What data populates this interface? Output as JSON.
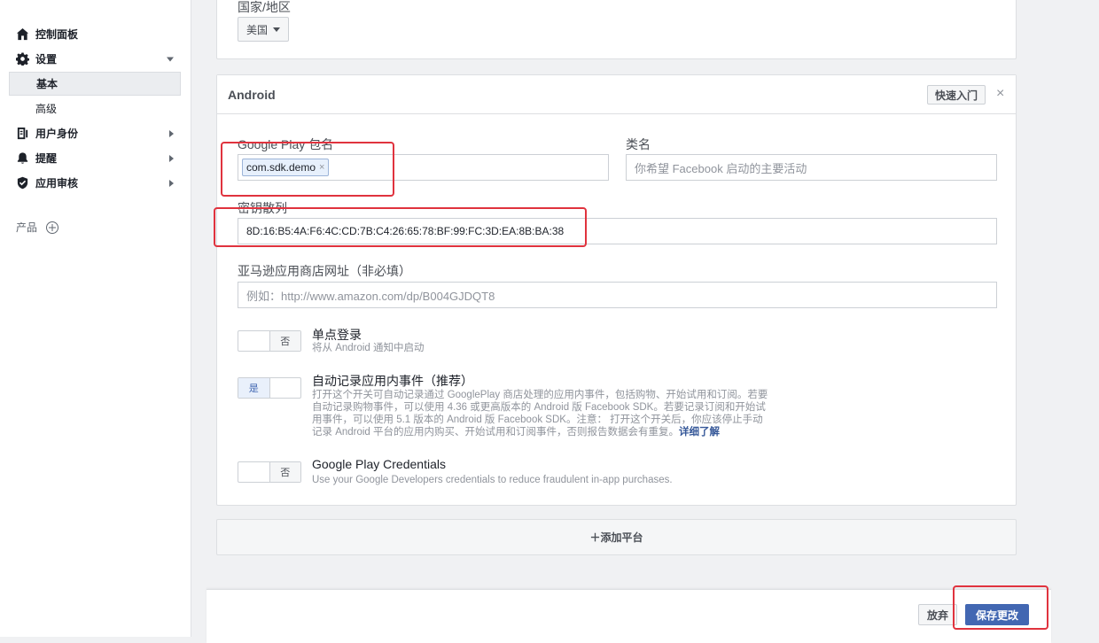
{
  "sidebar": {
    "dashboard": "控制面板",
    "settings": "设置",
    "settings_basic": "基本",
    "settings_advanced": "高级",
    "roles": "用户身份",
    "alerts": "提醒",
    "app_review": "应用审核",
    "products": "产品"
  },
  "country": {
    "label": "国家/地区",
    "value": "美国"
  },
  "android": {
    "title": "Android",
    "quickstart": "快速入门",
    "close": "×",
    "package_label": "Google Play 包名",
    "package_tag": "com.sdk.demo",
    "package_tag_remove": "×",
    "class_label": "类名",
    "class_placeholder": "你希望 Facebook 启动的主要活动",
    "key_hash_label": "密钥散列",
    "key_hash_value": "8D:16:B5:4A:F6:4C:CD:7B:C4:26:65:78:BF:99:FC:3D:EA:8B:BA:38",
    "amazon_label": "亚马逊应用商店网址（非必填）",
    "amazon_placeholder": "例如：http://www.amazon.com/dp/B004GJDQT8",
    "sso_toggle": "否",
    "sso_title": "单点登录",
    "sso_desc": "将从 Android 通知中启动",
    "autolog_toggle": "是",
    "autolog_title": "自动记录应用内事件（推荐）",
    "autolog_desc_1": "打开这个开关可自动记录通过 GooglePlay 商店处理的应用内事件，包括购物、开始试用和订阅。若要",
    "autolog_desc_2": "自动记录购物事件，可以使用 4.36 或更高版本的 Android 版 Facebook SDK。若要记录订阅和开始试",
    "autolog_desc_3": "用事件，可以使用 5.1 版本的 Android 版 Facebook SDK。注意： 打开这个开关后，你应该停止手动",
    "autolog_desc_4": "记录 Android 平台的应用内购买、开始试用和订阅事件，否则报告数据会有重复。",
    "autolog_learn_more": "详细了解",
    "gpc_toggle": "否",
    "gpc_title": "Google Play Credentials",
    "gpc_desc": "Use your Google Developers credentials to reduce fraudulent in-app purchases."
  },
  "add_platform": "＋添加平台",
  "footer": {
    "discard": "放弃",
    "save": "保存更改"
  },
  "colors": {
    "accent": "#4267b2",
    "highlight": "#e0333e"
  }
}
